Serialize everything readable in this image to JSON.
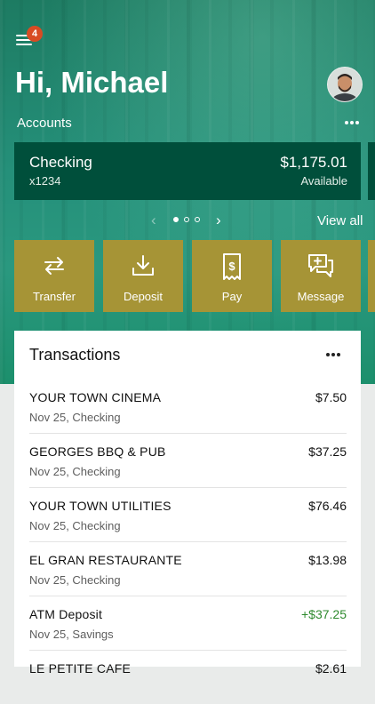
{
  "header": {
    "menu_badge": "4",
    "greeting": "Hi, Michael"
  },
  "accounts": {
    "section_label": "Accounts",
    "card": {
      "name": "Checking",
      "number": "x1234",
      "balance": "$1,175.01",
      "balance_label": "Available"
    },
    "pager": {
      "pages": 3,
      "current": 1
    },
    "view_all": "View all"
  },
  "actions": [
    {
      "label": "Transfer",
      "icon": "transfer-icon"
    },
    {
      "label": "Deposit",
      "icon": "deposit-icon"
    },
    {
      "label": "Pay",
      "icon": "pay-icon"
    },
    {
      "label": "Message",
      "icon": "message-icon"
    }
  ],
  "transactions": {
    "title": "Transactions",
    "items": [
      {
        "merchant": "YOUR TOWN CINEMA",
        "meta": "Nov 25, Checking",
        "amount": "$7.50",
        "credit": false
      },
      {
        "merchant": "GEORGES BBQ & PUB",
        "meta": "Nov 25, Checking",
        "amount": "$37.25",
        "credit": false
      },
      {
        "merchant": "YOUR TOWN UTILITIES",
        "meta": "Nov 25, Checking",
        "amount": "$76.46",
        "credit": false
      },
      {
        "merchant": "EL GRAN RESTAURANTE",
        "meta": "Nov 25, Checking",
        "amount": "$13.98",
        "credit": false
      },
      {
        "merchant": "ATM Deposit",
        "meta": "Nov 25, Savings",
        "amount": "+$37.25",
        "credit": true
      },
      {
        "merchant": "LE PETITE CAFE",
        "meta": "",
        "amount": "$2.61",
        "credit": false
      }
    ]
  },
  "colors": {
    "brand_green": "#1d7b62",
    "card_green": "#004f3b",
    "action_gold": "#a69436",
    "badge_red": "#d84b23",
    "credit_green": "#2e8a2e"
  }
}
